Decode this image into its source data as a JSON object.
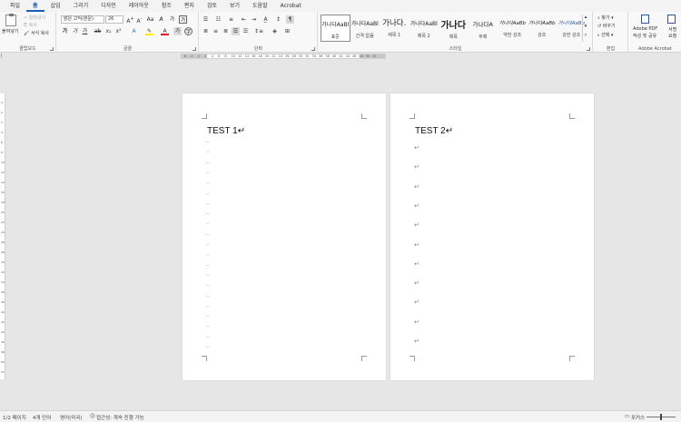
{
  "tabs": [
    {
      "label": "파일",
      "active": false
    },
    {
      "label": "홈",
      "active": true
    },
    {
      "label": "삽입",
      "active": false
    },
    {
      "label": "그리기",
      "active": false
    },
    {
      "label": "디자인",
      "active": false
    },
    {
      "label": "레이아웃",
      "active": false
    },
    {
      "label": "참조",
      "active": false
    },
    {
      "label": "편지",
      "active": false
    },
    {
      "label": "검토",
      "active": false
    },
    {
      "label": "보기",
      "active": false
    },
    {
      "label": "도움말",
      "active": false
    },
    {
      "label": "Acrobat",
      "active": false
    }
  ],
  "clipboard": {
    "paste": "붙여넣기",
    "cut": "잘라내기",
    "copy": "복사",
    "format_painter": "서식 복사",
    "label": "클립보드"
  },
  "font": {
    "name": "맑은 고딕(본문)",
    "size": "26",
    "label": "글꼴"
  },
  "paragraph": {
    "label": "단락"
  },
  "styles": {
    "label": "스타일",
    "items": [
      {
        "sample": "가나다AaBl",
        "name": "표준",
        "selected": true
      },
      {
        "sample": "가나다AaBl",
        "name": "간격 없음",
        "selected": false
      },
      {
        "sample": "가나다.",
        "name": "제목 1",
        "selected": false
      },
      {
        "sample": "가나다AaBl",
        "name": "제목 2",
        "selected": false
      },
      {
        "sample": "가나다",
        "name": "제목",
        "selected": false
      },
      {
        "sample": "가나다A",
        "name": "부제",
        "selected": false
      },
      {
        "sample": "가나다AaBb",
        "name": "약한 강조",
        "selected": false
      },
      {
        "sample": "가나다AaBb",
        "name": "강조",
        "selected": false
      },
      {
        "sample": "가나다AaBb",
        "name": "강한 강조",
        "selected": false
      }
    ]
  },
  "editing": {
    "find": "찾기",
    "replace": "바꾸기",
    "select": "선택",
    "label": "편집"
  },
  "acrobat": {
    "create_pdf_line1": "Adobe PDF",
    "create_pdf_line2": "작성 및 공유",
    "sign_line1": "서명",
    "sign_line2": "요청",
    "label": "Adobe Acrobat"
  },
  "pages": [
    {
      "title": "TEST 1↵",
      "mark": "··"
    },
    {
      "title": "TEST 2↵",
      "mark": "↵"
    }
  ],
  "status": {
    "page": "1/2 페이지",
    "words": "4개 단어",
    "language": "영어(미국)",
    "accessibility": "접근성: 계속 진행 가능",
    "focus": "포커스"
  }
}
